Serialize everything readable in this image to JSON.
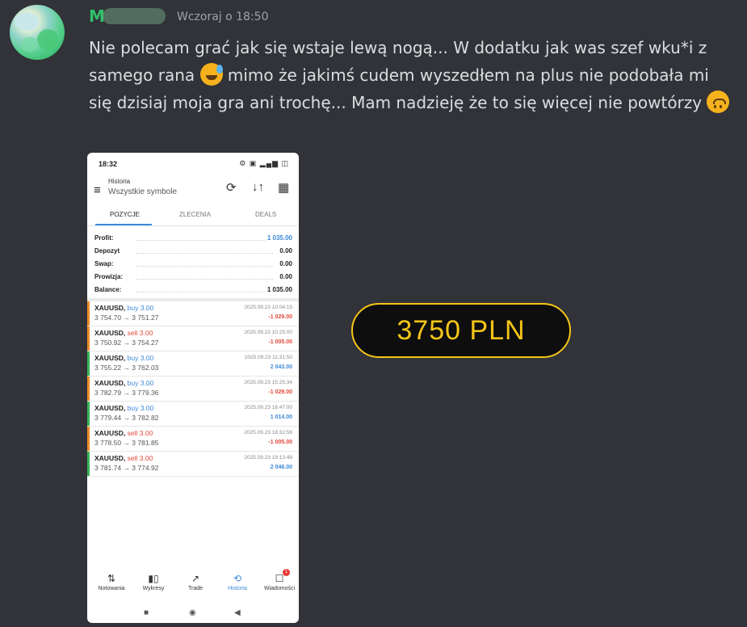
{
  "post": {
    "author": "M",
    "timestamp": "Wczoraj o 18:50",
    "message_part1": "Nie polecam grać jak się wstaje lewą nogą... W dodatku jak was szef wku*i z samego rana ",
    "emoji1": "sweat-smile-emoji",
    "message_part2": " mimo że jakimś cudem wyszedłem na plus nie podobała mi się dzisiaj moja gra ani trochę... Mam nadzieję że to się więcej nie powtórzy ",
    "emoji2": "upside-down-face-emoji"
  },
  "phone": {
    "status_time": "18:32",
    "status_icons": "⚙ ▣ ▂▄▆ ◫",
    "header_small": "Historia",
    "header_sub": "Wszystkie symbole",
    "tabs": [
      "POZYCJE",
      "ZLECENIA",
      "DEALS"
    ],
    "summary": [
      {
        "label": "Profit:",
        "value": "1 035.00",
        "highlight": true
      },
      {
        "label": "Depozyt",
        "value": "0.00"
      },
      {
        "label": "Swap:",
        "value": "0.00"
      },
      {
        "label": "Prowizja:",
        "value": "0.00"
      },
      {
        "label": "Balance:",
        "value": "1 035.00"
      }
    ],
    "trades": [
      {
        "symbol": "XAUUSD,",
        "side": "buy 3.00",
        "price": "3 754.70 → 3 751.27",
        "date": "2025.09.23 10:04:15",
        "profit": "-1 029.00"
      },
      {
        "symbol": "XAUUSD,",
        "side": "sell 3.00",
        "price": "3 750.92 → 3 754.27",
        "date": "2025.09.23 10:25:00",
        "profit": "-1 005.00"
      },
      {
        "symbol": "XAUUSD,",
        "side": "buy 3.00",
        "price": "3 755.22 → 3 762.03",
        "date": "2025.09.23 11:31:50",
        "profit": "2 043.00"
      },
      {
        "symbol": "XAUUSD,",
        "side": "buy 3.00",
        "price": "3 782.79 → 3 779.36",
        "date": "2025.09.23 15:25:34",
        "profit": "-1 029.00"
      },
      {
        "symbol": "XAUUSD,",
        "side": "buy 3.00",
        "price": "3 779.44 → 3 782.82",
        "date": "2025.09.23 16:47:00",
        "profit": "1 014.00"
      },
      {
        "symbol": "XAUUSD,",
        "side": "sell 3.00",
        "price": "3 778.50 → 3 781.85",
        "date": "2025.09.23 18:32:56",
        "profit": "-1 005.00"
      },
      {
        "symbol": "XAUUSD,",
        "side": "sell 3.00",
        "price": "3 781.74 → 3 774.92",
        "date": "2025.09.23 19:13:49",
        "profit": "2 046.00"
      }
    ],
    "nav": [
      {
        "label": "Notowania",
        "icon": "arrows-icon",
        "glyph": "⇅"
      },
      {
        "label": "Wykresy",
        "icon": "candles-icon",
        "glyph": "▮▯"
      },
      {
        "label": "Trade",
        "icon": "trend-icon",
        "glyph": "↗"
      },
      {
        "label": "Historia",
        "icon": "history-icon",
        "glyph": "⟲"
      },
      {
        "label": "Wiadomości",
        "icon": "messages-icon",
        "glyph": "☐"
      }
    ],
    "badge": "1"
  },
  "price_tag": "3750 PLN",
  "colors": {
    "background": "#313338",
    "author": "#30c26a",
    "accent_blue": "#3d8ad8",
    "loss_red": "#e0483a",
    "buy_blue": "#3d8ad8",
    "sell_red": "#e0483a",
    "pill": "#f5c518",
    "bar_orange": "#f08c2a",
    "bar_green": "#3bb55a"
  }
}
